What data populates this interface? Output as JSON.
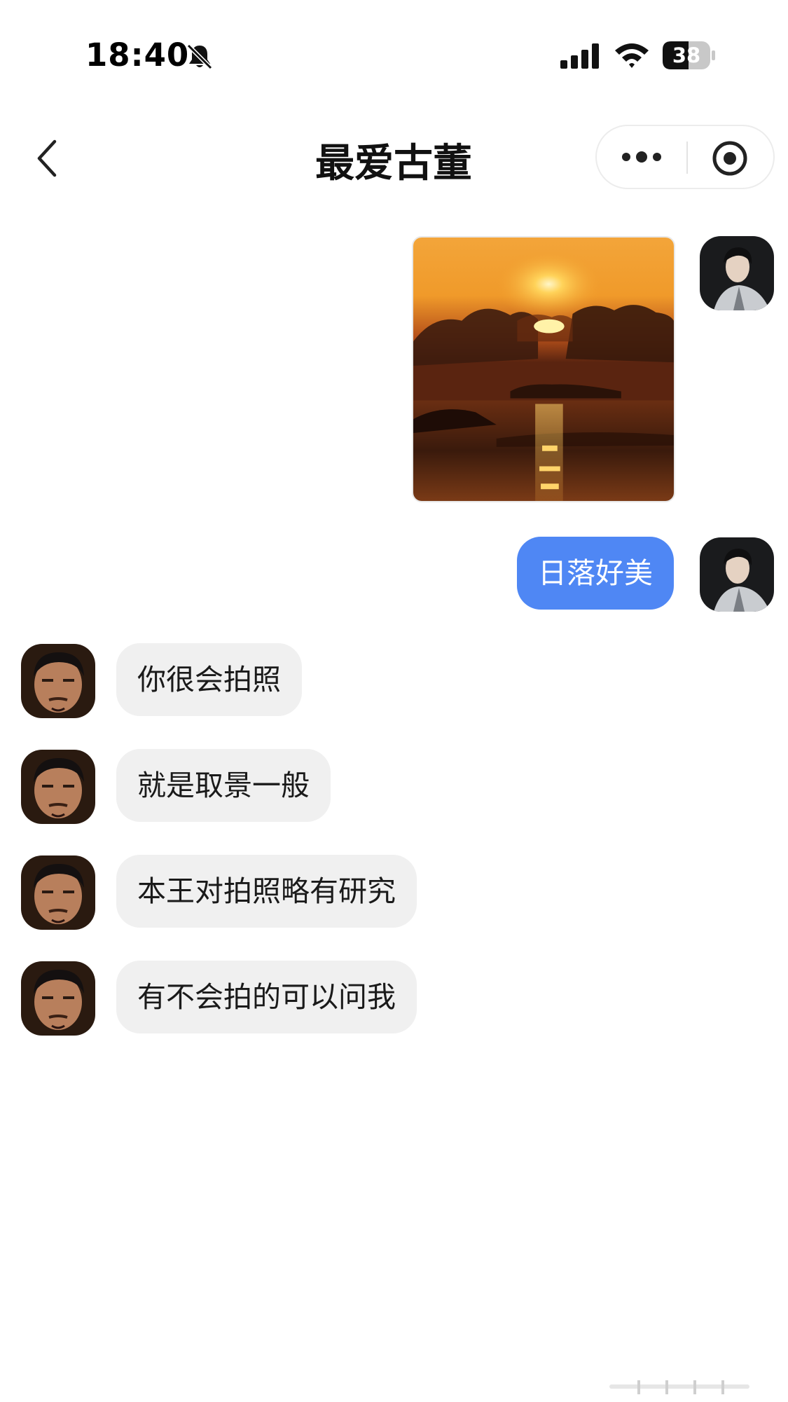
{
  "status_bar": {
    "time": "18:40",
    "battery": "38",
    "icons": [
      "bell-slash-icon",
      "signal-icon",
      "wifi-icon",
      "battery-icon"
    ]
  },
  "nav": {
    "title": "最爱古董",
    "icons": [
      "back-icon",
      "more-icon",
      "close-icon"
    ]
  },
  "messages": [
    {
      "sender": "me",
      "type": "image",
      "image": "sunset-over-sea"
    },
    {
      "sender": "me",
      "type": "text",
      "text": "日落好美"
    },
    {
      "sender": "other",
      "type": "text",
      "text": "你很会拍照"
    },
    {
      "sender": "other",
      "type": "text",
      "text": "就是取景一般"
    },
    {
      "sender": "other",
      "type": "text",
      "text": "本王对拍照略有研究"
    },
    {
      "sender": "other",
      "type": "text",
      "text": "有不会拍的可以问我"
    }
  ],
  "colors": {
    "my_bubble": "#4f87f4",
    "other_bubble": "#f0f0f0",
    "background": "#ffffff"
  }
}
